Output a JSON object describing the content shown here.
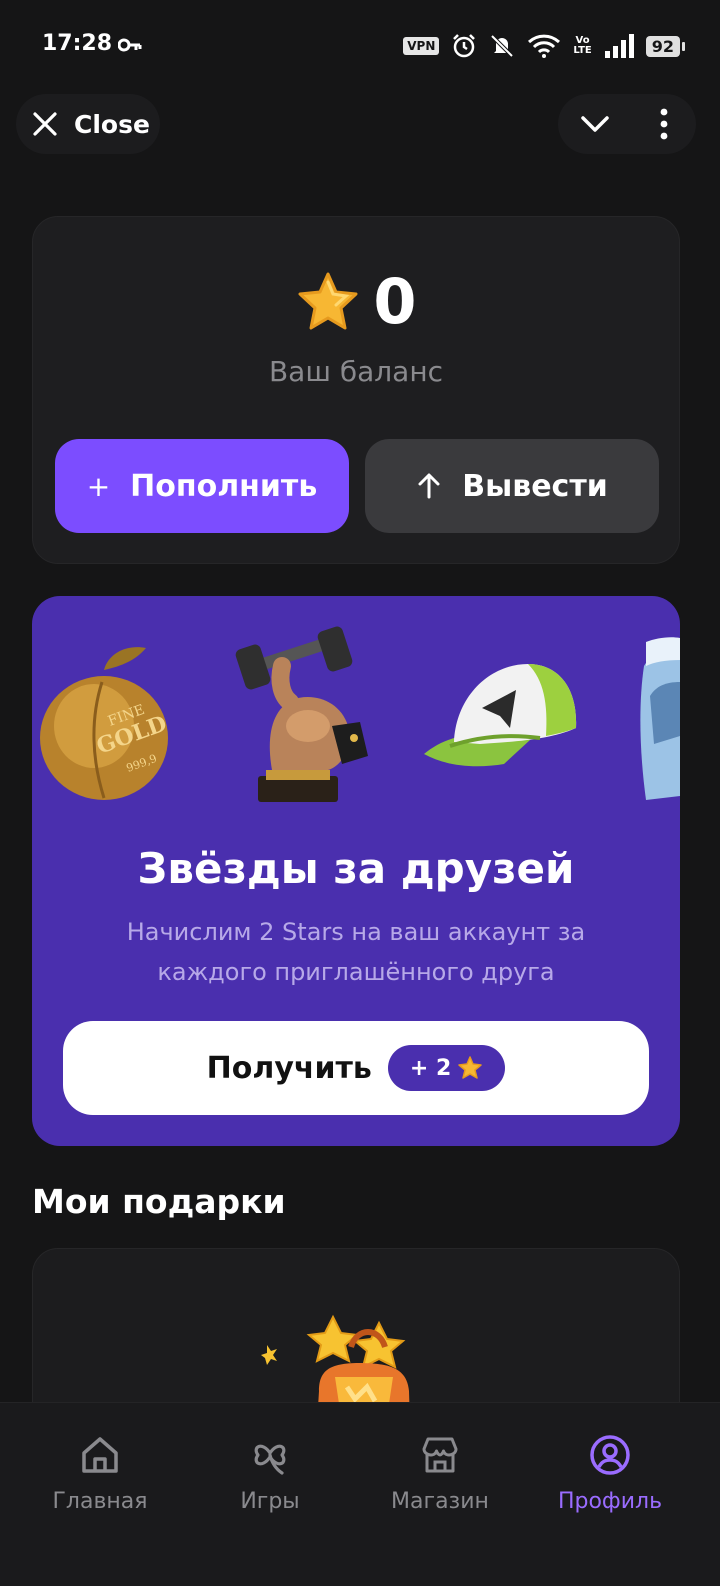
{
  "status_bar": {
    "time": "17:28",
    "vpn": "VPN",
    "volte_top": "Vo",
    "volte_bottom": "LTE",
    "battery": "92"
  },
  "header": {
    "close_label": "Close"
  },
  "balance": {
    "value": "0",
    "label": "Ваш баланс",
    "topup_label": "Пополнить",
    "withdraw_label": "Вывести"
  },
  "promo": {
    "title": "Звёзды за друзей",
    "text": "Начислим 2 Stars на ваш аккаунт за каждого приглашённого друга",
    "button_label": "Получить",
    "badge": "+ 2",
    "gift_text_1": "FINE",
    "gift_text_2": "GOLD",
    "gift_text_3": "999,9"
  },
  "gifts": {
    "title": "Мои подарки"
  },
  "nav": {
    "items": [
      {
        "label": "Главная",
        "icon": "home-icon"
      },
      {
        "label": "Игры",
        "icon": "clover-icon"
      },
      {
        "label": "Магазин",
        "icon": "store-icon"
      },
      {
        "label": "Профиль",
        "icon": "profile-icon"
      }
    ],
    "active": "Профиль"
  },
  "colors": {
    "accent": "#7c4dff",
    "promo_bg": "#4a2fae",
    "background": "#151516"
  }
}
